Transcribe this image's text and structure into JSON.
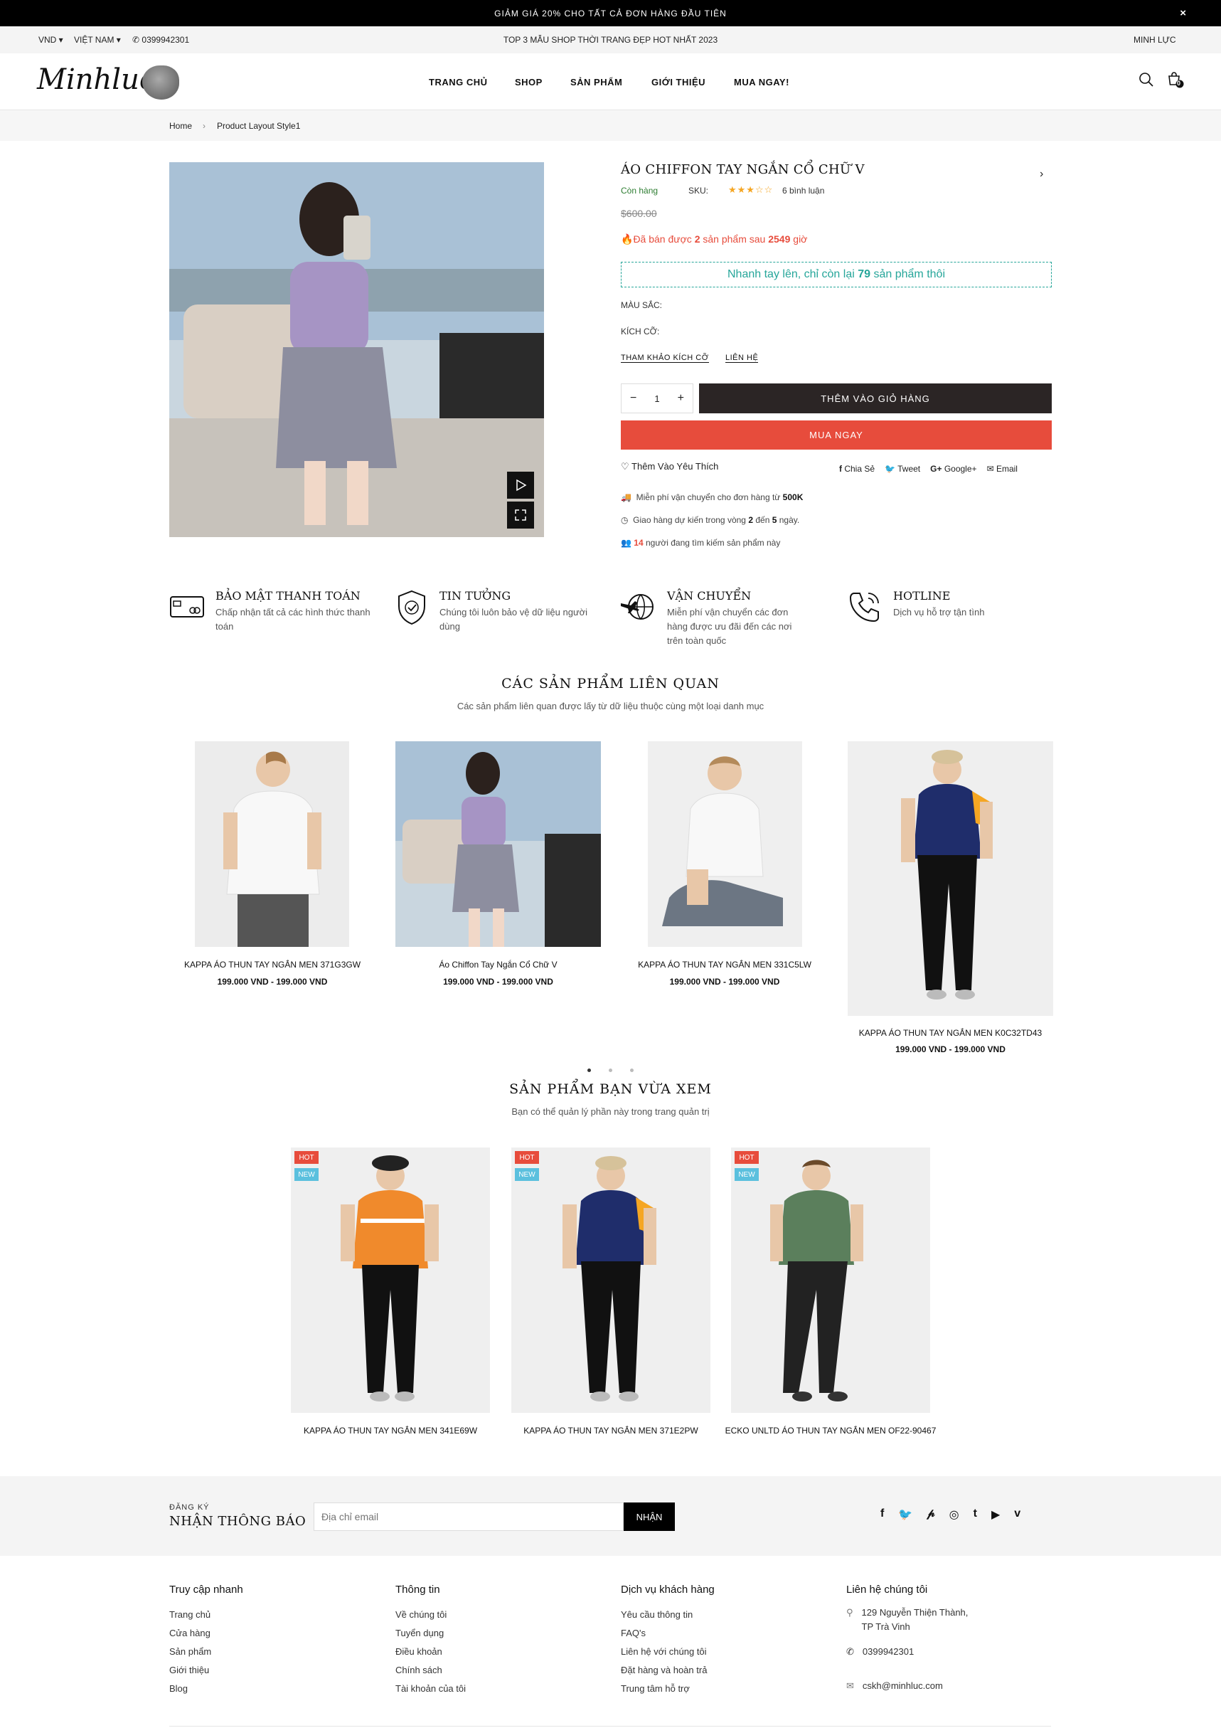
{
  "announcement": {
    "text": "GIẢM GIÁ 20% CHO TẤT CẢ ĐƠN HÀNG ĐẦU TIÊN",
    "close": "×"
  },
  "topbar": {
    "currency": "VND",
    "country": "VIỆT NAM",
    "phone": "0399942301",
    "promo": "TOP 3 MẪU SHOP THỜI TRANG ĐẸP HOT NHẤT 2023",
    "account": "MINH LỰC"
  },
  "header": {
    "logo": "Minhluc",
    "nav": [
      "TRANG CHỦ",
      "SHOP",
      "SẢN PHẨM",
      "GIỚI THIỆU",
      "MUA NGAY!"
    ],
    "cart_count": "0"
  },
  "breadcrumb": {
    "home": "Home",
    "sep": "›",
    "current": "Product Layout Style1"
  },
  "product": {
    "title": "ÁO CHIFFON TAY NGẮN CỔ CHỮ V",
    "stock": "Còn hàng",
    "sku_label": "SKU:",
    "rating": 3,
    "reviews": "6 bình luận",
    "price": "$600.00",
    "sold_prefix": "Đã bán được",
    "sold_qty": "2",
    "sold_mid": "sản phẩm sau",
    "sold_hours": "2549",
    "sold_suffix": "giờ",
    "hurry_prefix": "Nhanh tay lên, chỉ còn lại",
    "hurry_qty": "79",
    "hurry_suffix": "sản phẩm thôi",
    "color_label": "MÀU SẮC:",
    "size_label": "KÍCH CỠ:",
    "size_guide": "THAM KHẢO KÍCH CỠ",
    "contact": "LIÊN HỆ",
    "qty": "1",
    "add_to_cart": "THÊM VÀO GIỎ HÀNG",
    "buy_now": "MUA NGAY",
    "wishlist": "Thêm Vào Yêu Thích",
    "share": [
      "Chia Sẻ",
      "Tweet",
      "Google+",
      "Email"
    ],
    "shipping_prefix": "Miễn phí vận chuyển cho đơn hàng từ",
    "shipping_min": "500K",
    "delivery_prefix": "Giao hàng dự kiến trong vòng",
    "delivery_from": "2",
    "delivery_mid": "đến",
    "delivery_to": "5",
    "delivery_suffix": "ngày.",
    "viewers_count": "14",
    "viewers_text": "người đang tìm kiếm sản phẩm này"
  },
  "features": [
    {
      "title": "BẢO MẬT THANH TOÁN",
      "desc": "Chấp nhận tất cả các hình thức thanh toán"
    },
    {
      "title": "TIN TƯỞNG",
      "desc": "Chúng tôi luôn bảo vệ dữ liệu người dùng"
    },
    {
      "title": "VẬN CHUYỂN",
      "desc": "Miễn phí vận chuyển các đơn hàng được ưu đãi đến các nơi trên toàn quốc"
    },
    {
      "title": "HOTLINE",
      "desc": "Dịch vụ hỗ trợ tận tình"
    }
  ],
  "related": {
    "title": "CÁC SẢN PHẨM LIÊN QUAN",
    "subtitle": "Các sản phẩm liên quan được lấy từ dữ liệu thuộc cùng một loại danh mục",
    "items": [
      {
        "name": "KAPPA ÁO THUN TAY NGẮN MEN 371G3GW",
        "price": "199.000 VND - 199.000 VND"
      },
      {
        "name": "Áo Chiffon Tay Ngắn Cổ Chữ V",
        "price": "199.000 VND - 199.000 VND"
      },
      {
        "name": "KAPPA ÁO THUN TAY NGẮN MEN 331C5LW",
        "price": "199.000 VND - 199.000 VND"
      },
      {
        "name": "KAPPA ÁO THUN TAY NGẮN MEN K0C32TD43",
        "price": "199.000 VND - 199.000 VND"
      }
    ]
  },
  "recent": {
    "title": "SẢN PHẨM BẠN VỪA XEM",
    "subtitle": "Bạn có thể quản lý phần này trong trang quản trị",
    "badge_hot": "HOT",
    "badge_new": "NEW",
    "items": [
      {
        "name": "KAPPA ÁO THUN TAY NGẮN MEN 341E69W"
      },
      {
        "name": "KAPPA ÁO THUN TAY NGẮN MEN 371E2PW"
      },
      {
        "name": "ECKO UNLTD ÁO THUN TAY NGẮN MEN OF22-90467"
      }
    ]
  },
  "newsletter": {
    "kicker": "ĐĂNG KÝ",
    "title": "NHẬN THÔNG BÁO",
    "placeholder": "Địa chỉ email",
    "button": "NHẬN"
  },
  "footer": {
    "col1": {
      "title": "Truy cập nhanh",
      "links": [
        "Trang chủ",
        "Cửa hàng",
        "Sản phẩm",
        "Giới thiệu",
        "Blog"
      ]
    },
    "col2": {
      "title": "Thông tin",
      "links": [
        "Về chúng tôi",
        "Tuyển dụng",
        "Điều khoản",
        "Chính sách",
        "Tài khoản của tôi"
      ]
    },
    "col3": {
      "title": "Dịch vụ khách hàng",
      "links": [
        "Yêu cầu thông tin",
        "FAQ's",
        "Liên hệ với chúng tôi",
        "Đặt hàng và hoàn trả",
        "Trung tâm hỗ trợ"
      ]
    },
    "col4": {
      "title": "Liên hệ chúng tôi",
      "address1": "129 Nguyễn Thiện Thành,",
      "address2": "TP Trà Vinh",
      "phone": "0399942301",
      "email": "cskh@minhluc.com"
    }
  },
  "colors": {
    "accent_red": "#e74c3c",
    "dark": "#2b2525",
    "teal": "#26a69a",
    "stock_green": "#2e7d32",
    "star": "#f5a623"
  }
}
